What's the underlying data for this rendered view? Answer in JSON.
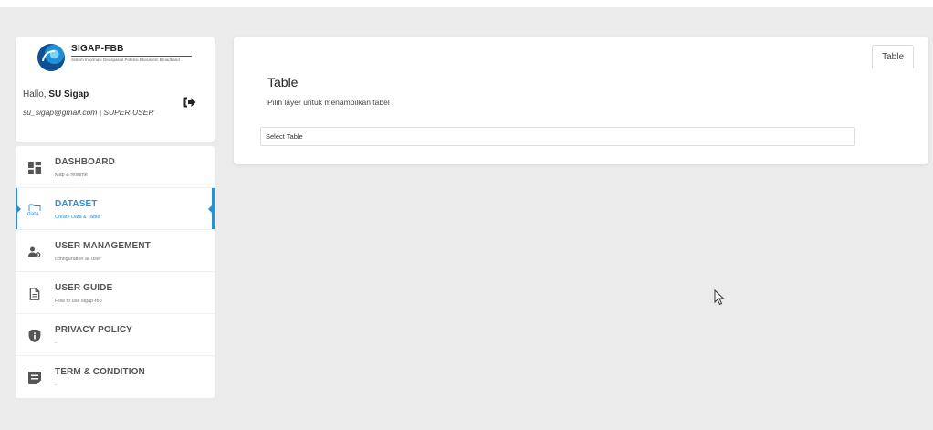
{
  "brand": {
    "name": "SIGAP-FBB",
    "subtitle": "Sistem Informasi Geospasial Potensi Ekosistem Broadband"
  },
  "user": {
    "greeting": "Hallo,",
    "name": "SU Sigap",
    "email_role": "su_sigap@gmail.com | SUPER USER"
  },
  "menu": [
    {
      "title": "DASHBOARD",
      "subtitle": "Map & resume",
      "icon": "dashboard-icon"
    },
    {
      "title": "DATASET",
      "subtitle": "Create Data & Table",
      "icon": "data-folder-icon",
      "icon_text": "data",
      "active": true
    },
    {
      "title": "USER MANAGEMENT",
      "subtitle": "configuration all user",
      "icon": "user-gear-icon"
    },
    {
      "title": "USER GUIDE",
      "subtitle": "How to use sigap-fbb",
      "icon": "document-icon"
    },
    {
      "title": "PRIVACY POLICY",
      "subtitle": "-",
      "icon": "shield-icon"
    },
    {
      "title": "TERM & CONDITION",
      "subtitle": "-",
      "icon": "note-icon"
    }
  ],
  "main": {
    "tab_label": "Table",
    "title": "Table",
    "description": "Pilih layer untuk menampilkan tabel :",
    "select_value": "Select Table"
  },
  "colors": {
    "accent": "#2a8fd8",
    "background": "#ebebeb"
  }
}
